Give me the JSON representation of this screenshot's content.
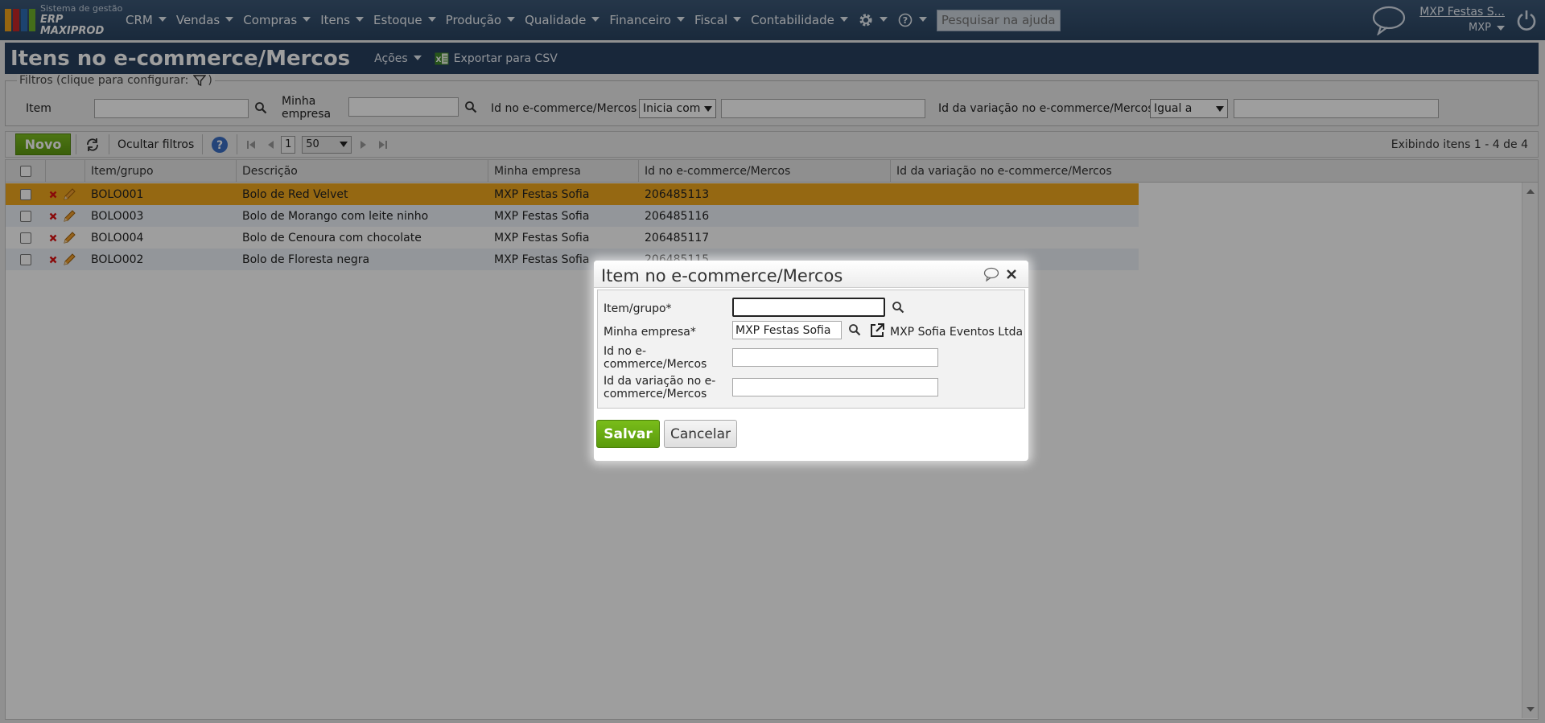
{
  "brand": {
    "line1": "Sistema de gestão",
    "line2": "ERP MAXIPROD",
    "colors": [
      "#f2a31b",
      "#c62828",
      "#2e6db4",
      "#6fb12b"
    ]
  },
  "nav": {
    "menus": [
      "CRM",
      "Vendas",
      "Compras",
      "Itens",
      "Estoque",
      "Produção",
      "Qualidade",
      "Financeiro",
      "Fiscal",
      "Contabilidade"
    ],
    "help_search_placeholder": "Pesquisar na ajuda..."
  },
  "user": {
    "company_link": "MXP Festas S...",
    "short_name": "MXP"
  },
  "page": {
    "title": "Itens no e-commerce/Mercos",
    "actions_label": "Ações",
    "export_label": "Exportar para CSV"
  },
  "filters": {
    "legend": "Filtros (clique para configurar:",
    "legend_close": ")",
    "item_label": "Item",
    "empresa_label_1": "Minha",
    "empresa_label_2": "empresa",
    "id_label": "Id no e-commerce/Mercos",
    "id_operator": "Inicia com",
    "variacao_label": "Id da variação no e-commerce/Mercos",
    "variacao_operator": "Igual a"
  },
  "toolbar": {
    "new_label": "Novo",
    "hide_filters_label": "Ocultar filtros",
    "page": "1",
    "per_page": "50",
    "showing": "Exibindo itens 1 - 4 de 4"
  },
  "grid": {
    "columns": [
      "Item/grupo",
      "Descrição",
      "Minha empresa",
      "Id no e-commerce/Mercos",
      "Id da variação no e-commerce/Mercos"
    ],
    "rows": [
      {
        "item": "BOLO001",
        "desc": "Bolo de Red Velvet",
        "empresa": "MXP Festas Sofia",
        "id": "206485113",
        "variacao": ""
      },
      {
        "item": "BOLO003",
        "desc": "Bolo de Morango com leite ninho",
        "empresa": "MXP Festas Sofia",
        "id": "206485116",
        "variacao": ""
      },
      {
        "item": "BOLO004",
        "desc": "Bolo de Cenoura com chocolate",
        "empresa": "MXP Festas Sofia",
        "id": "206485117",
        "variacao": ""
      },
      {
        "item": "BOLO002",
        "desc": "Bolo de Floresta negra",
        "empresa": "MXP Festas Sofia",
        "id": "206485115",
        "variacao": ""
      }
    ],
    "selected_row_color": "#f0a81e"
  },
  "dialog": {
    "title": "Item no e-commerce/Mercos",
    "item_label": "Item/grupo*",
    "item_value": "",
    "empresa_label": "Minha empresa*",
    "empresa_value": "MXP Festas Sofia",
    "empresa_full_name": "MXP Sofia Eventos Ltda",
    "id_label_1": "Id no e-",
    "id_label_2": "commerce/Mercos",
    "id_value": "",
    "variacao_label_1": "Id da variação no e-",
    "variacao_label_2": "commerce/Mercos",
    "variacao_value": "",
    "save_label": "Salvar",
    "cancel_label": "Cancelar"
  }
}
